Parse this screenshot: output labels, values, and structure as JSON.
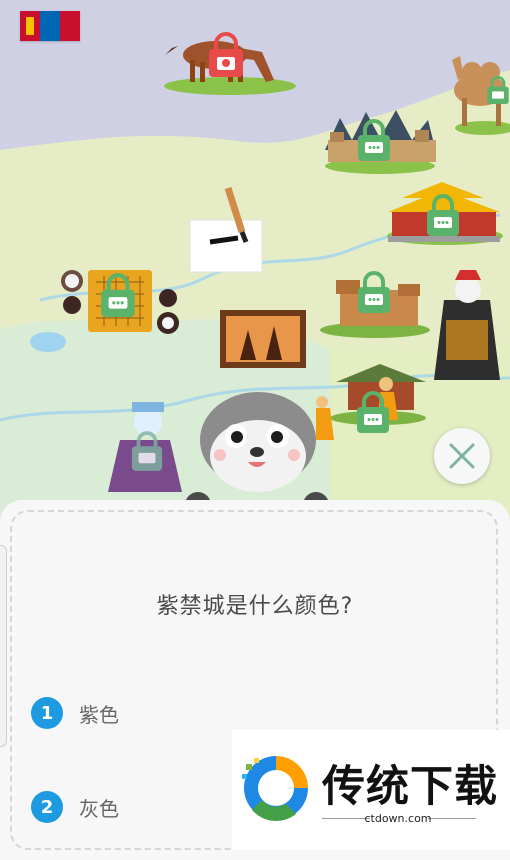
{
  "quiz": {
    "question": "紫禁城是什么颜色?",
    "options": [
      {
        "number": "1",
        "label": "紫色"
      },
      {
        "number": "2",
        "label": "灰色"
      }
    ]
  },
  "watermark": {
    "title": "传统下载",
    "url": "ctdown.com"
  },
  "colors": {
    "accent": "#1e9be0",
    "lock_green": "#5bb36b",
    "lock_red": "#e84a4a",
    "panel": "#f7f7f7"
  },
  "icons": [
    "mongolia-flag-icon",
    "camera-icon",
    "chat-icon",
    "close-icon"
  ]
}
